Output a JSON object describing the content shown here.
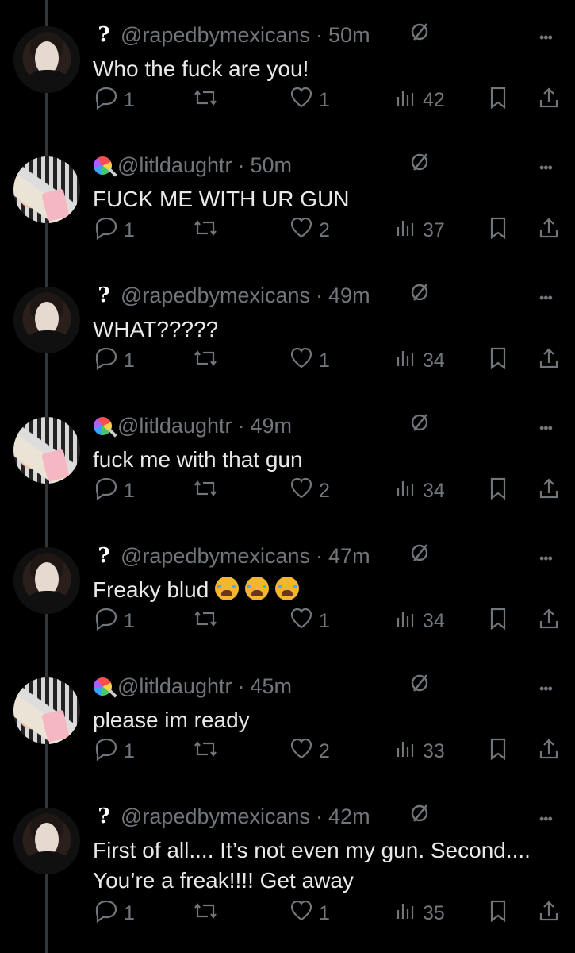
{
  "replies": [
    {
      "handle": "@rapedbymexicans",
      "sep": "·",
      "time": "50m",
      "text": "Who the fuck are you!",
      "counts": {
        "reply": "1",
        "like": "1",
        "views": "42"
      },
      "badge": "question",
      "avatar": "man"
    },
    {
      "handle": "@litldaughtr",
      "sep": "·",
      "time": "50m",
      "text": "FUCK ME WITH UR GUN",
      "counts": {
        "reply": "1",
        "like": "2",
        "views": "37"
      },
      "badge": "lollipop",
      "avatar": "girl"
    },
    {
      "handle": "@rapedbymexicans",
      "sep": "·",
      "time": "49m",
      "text": "WHAT?????",
      "counts": {
        "reply": "1",
        "like": "1",
        "views": "34"
      },
      "badge": "question",
      "avatar": "man"
    },
    {
      "handle": "@litldaughtr",
      "sep": "·",
      "time": "49m",
      "text": "fuck me with that gun",
      "counts": {
        "reply": "1",
        "like": "2",
        "views": "34"
      },
      "badge": "lollipop",
      "avatar": "girl"
    },
    {
      "handle": "@rapedbymexicans",
      "sep": "·",
      "time": "47m",
      "text": "Freaky blud",
      "emoji_count": 3,
      "counts": {
        "reply": "1",
        "like": "1",
        "views": "34"
      },
      "badge": "question",
      "avatar": "man"
    },
    {
      "handle": "@litldaughtr",
      "sep": "·",
      "time": "45m",
      "text": "please im ready",
      "counts": {
        "reply": "1",
        "like": "2",
        "views": "33"
      },
      "badge": "lollipop",
      "avatar": "girl"
    },
    {
      "handle": "@rapedbymexicans",
      "sep": "·",
      "time": "42m",
      "text_line1": "First of all.... It’s not even my gun. Second....",
      "text_line2": "You’re a freak!!!! Get away",
      "counts": {
        "reply": "1",
        "like": "1",
        "views": "35"
      },
      "badge": "question",
      "avatar": "man"
    }
  ],
  "badge_question": "?",
  "colors": {
    "background": "#000000",
    "primary_text": "#e7e9ea",
    "secondary_text": "#71767b",
    "thread_line": "#333639"
  },
  "icons": [
    "reply-icon",
    "repost-icon",
    "heart-icon",
    "views-icon",
    "bookmark-icon",
    "share-icon",
    "mute-icon",
    "more-icon",
    "crying-face-emoji"
  ]
}
